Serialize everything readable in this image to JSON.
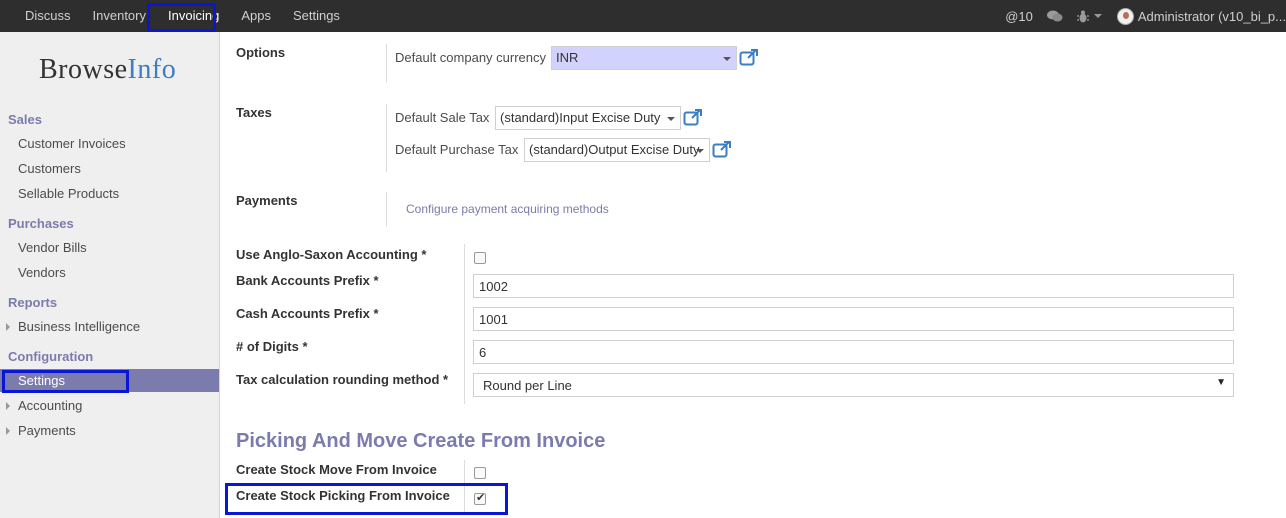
{
  "topbar": {
    "menus": [
      "Discuss",
      "Inventory",
      "Invoicing",
      "Apps",
      "Settings"
    ],
    "messages_count": "@10",
    "user": "Administrator (v10_bi_p...",
    "icons": [
      "chat-icon",
      "bug-icon",
      "caret-down-icon",
      "avatar"
    ]
  },
  "sidebar": {
    "logo_left": "Browse",
    "logo_right": "Info",
    "sections": {
      "sales": "Sales",
      "purchases": "Purchases",
      "reports": "Reports",
      "configuration": "Configuration"
    },
    "items": {
      "customer_invoices": "Customer Invoices",
      "customers": "Customers",
      "sellable_products": "Sellable Products",
      "vendor_bills": "Vendor Bills",
      "vendors": "Vendors",
      "business_intelligence": "Business Intelligence",
      "settings": "Settings",
      "accounting": "Accounting",
      "payments": "Payments"
    }
  },
  "main": {
    "options_label": "Options",
    "currency_label": "Default company currency",
    "currency_value": "INR",
    "taxes_label": "Taxes",
    "sale_tax_label": "Default Sale Tax",
    "sale_tax_value": "(standard)Input Excise Duty",
    "purchase_tax_label": "Default Purchase Tax",
    "purchase_tax_value": "(standard)Output Excise Duty",
    "payments_label": "Payments",
    "payments_link": "Configure payment acquiring methods",
    "anglo_label": "Use Anglo-Saxon Accounting *",
    "bank_prefix_label": "Bank Accounts Prefix *",
    "bank_prefix_value": "1002",
    "cash_prefix_label": "Cash Accounts Prefix *",
    "cash_prefix_value": "1001",
    "digits_label": "# of Digits *",
    "digits_value": "6",
    "rounding_label": "Tax calculation rounding method *",
    "rounding_value": "Round per Line",
    "section_title": "Picking And Move Create From Invoice",
    "stock_move_label": "Create Stock Move From Invoice",
    "stock_move_checked": false,
    "stock_picking_label": "Create Stock Picking From Invoice",
    "stock_picking_checked": true
  },
  "colors": {
    "accent": "#7c7bad",
    "highlight_box": "#0a16d6",
    "topbar": "#2e2e2e"
  }
}
